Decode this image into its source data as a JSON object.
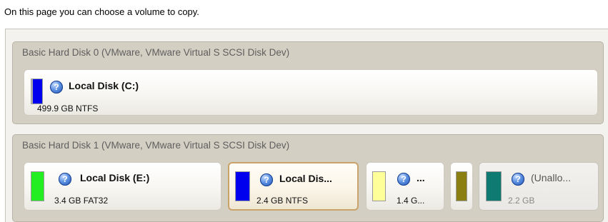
{
  "instruction": "On this page you can choose a volume to copy.",
  "disks": [
    {
      "title": "Basic Hard Disk 0 (VMware, VMware Virtual S SCSI Disk Dev)",
      "volumes": [
        {
          "name": "Local Disk (C:)",
          "info": "499.9 GB NTFS",
          "color": "#0000ee",
          "icon": "help-icon",
          "selected": false
        }
      ]
    },
    {
      "title": "Basic Hard Disk 1 (VMware, VMware Virtual S SCSI Disk Dev)",
      "volumes": [
        {
          "name": "Local Disk (E:)",
          "info": "3.4 GB FAT32",
          "color": "#22ee22",
          "icon": "help-icon",
          "selected": false
        },
        {
          "name": "Local Dis...",
          "info": "2.4 GB NTFS",
          "color": "#0000ee",
          "icon": "help-icon",
          "selected": true
        },
        {
          "name": "...",
          "info": "1.4 G...",
          "color": "#ffff99",
          "icon": "help-icon",
          "selected": false
        },
        {
          "name": "",
          "info": "",
          "color": "#8a7f10",
          "icon": "",
          "selected": false
        },
        {
          "name": "(Unallo...",
          "info": "2.2 GB",
          "color": "#0e7a72",
          "icon": "help-icon",
          "selected": false
        }
      ]
    }
  ]
}
